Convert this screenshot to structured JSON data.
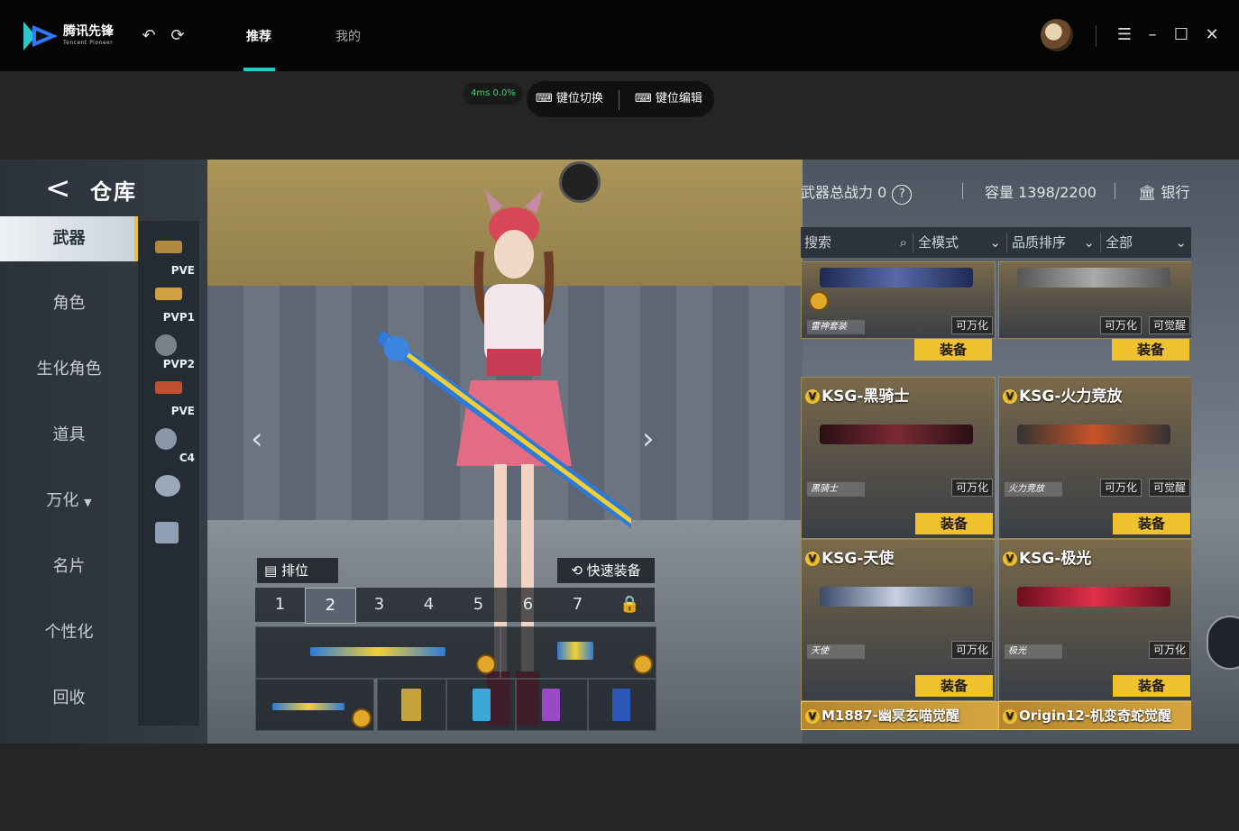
{
  "app": {
    "logo_text": "腾讯先锋",
    "logo_sub": "Tencent Pioneer",
    "tabs": [
      "推荐",
      "我的"
    ],
    "active_tab": "推荐"
  },
  "overlay": {
    "ping": "4ms",
    "loss": "0.0%",
    "key_switch": "键位切换",
    "key_edit": "键位编辑"
  },
  "game": {
    "title": "仓库",
    "menu": [
      "武器",
      "角色",
      "生化角色",
      "道具",
      "万化",
      "名片",
      "个性化",
      "回收"
    ],
    "sub_tabs": [
      "PVE",
      "PVP1",
      "PVP2",
      "PVE",
      "C4",
      "",
      ""
    ],
    "power_label": "武器总战力",
    "power_value": "0",
    "capacity_label": "容量",
    "capacity_value": "1398/2200",
    "bank_label": "银行",
    "sort_label": "排位",
    "quick_equip_label": "快速装备",
    "slots": [
      "1",
      "2",
      "3",
      "4",
      "5",
      "6",
      "7"
    ],
    "filters": {
      "search_placeholder": "搜索",
      "mode": "全模式",
      "sort": "品质排序",
      "category": "全部"
    },
    "equip_label": "装备",
    "cards": [
      {
        "name": "",
        "skin": "雷神套装",
        "tags": [
          "可万化"
        ]
      },
      {
        "name": "",
        "skin": "",
        "tags": [
          "可万化",
          "可觉醒"
        ]
      },
      {
        "name": "KSG-黑骑士",
        "skin": "黑骑士",
        "tags": [
          "可万化"
        ]
      },
      {
        "name": "KSG-火力竞放",
        "skin": "火力竞放",
        "tags": [
          "可万化",
          "可觉醒"
        ]
      },
      {
        "name": "KSG-天使",
        "skin": "天使",
        "tags": [
          "可万化"
        ]
      },
      {
        "name": "KSG-极光",
        "skin": "极光",
        "tags": [
          "可万化"
        ]
      }
    ],
    "bottom_cards": [
      "M1887-幽冥玄喵觉醒",
      "Origin12-机变奇蛇觉醒"
    ],
    "colors": {
      "accent": "#2cc7c9",
      "equip": "#f0c12e",
      "ping": "#3bd66b"
    }
  }
}
